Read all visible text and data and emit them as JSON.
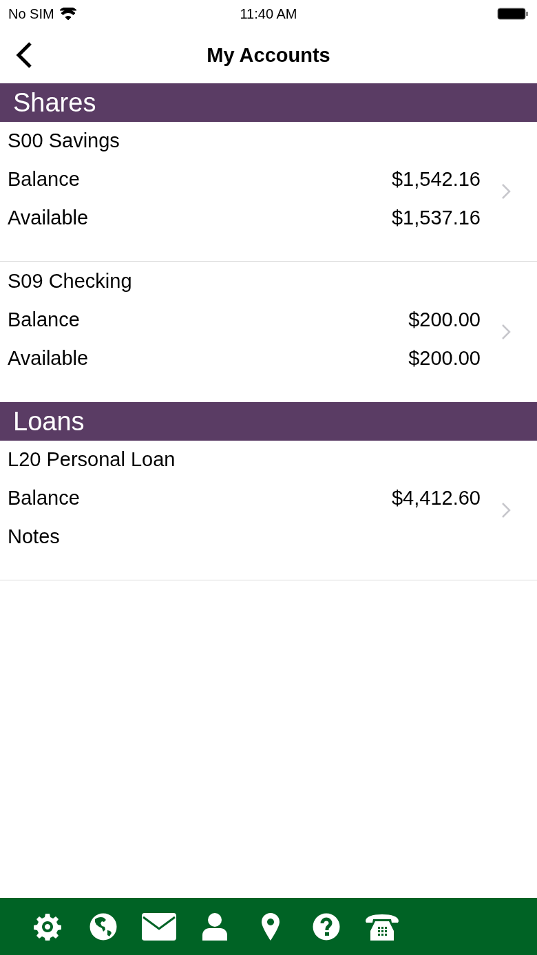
{
  "status_bar": {
    "carrier": "No SIM",
    "time": "11:40 AM"
  },
  "nav_bar": {
    "title": "My Accounts"
  },
  "sections": [
    {
      "title": "Shares",
      "accounts": [
        {
          "name": "S00 Savings",
          "lines": [
            {
              "label": "Balance",
              "value": "$1,542.16"
            },
            {
              "label": "Available",
              "value": "$1,537.16"
            }
          ],
          "divider": true
        },
        {
          "name": "S09 Checking",
          "lines": [
            {
              "label": "Balance",
              "value": "$200.00"
            },
            {
              "label": "Available",
              "value": "$200.00"
            }
          ],
          "divider": false
        }
      ]
    },
    {
      "title": "Loans",
      "accounts": [
        {
          "name": "L20 Personal Loan",
          "lines": [
            {
              "label": "Balance",
              "value": "$4,412.60"
            },
            {
              "label": "Notes"
            }
          ],
          "divider": true
        }
      ]
    }
  ],
  "tab_bar": {
    "items": [
      {
        "kind": "settings"
      },
      {
        "kind": "globe"
      },
      {
        "kind": "mail"
      },
      {
        "kind": "person"
      },
      {
        "kind": "pin"
      },
      {
        "kind": "help"
      },
      {
        "kind": "phone"
      }
    ]
  }
}
